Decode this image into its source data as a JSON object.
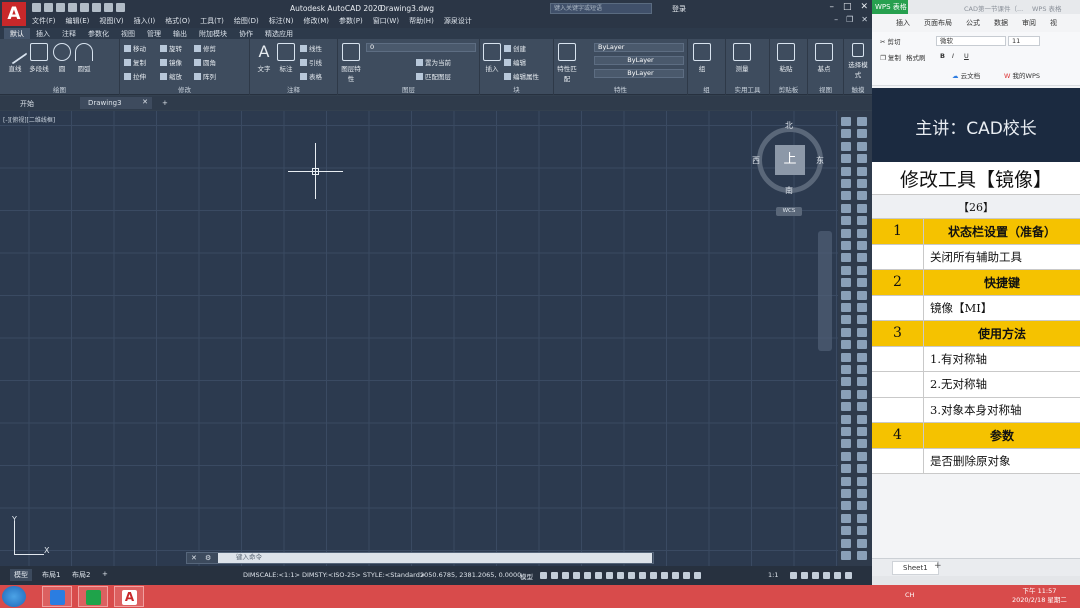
{
  "cad": {
    "title": "Autodesk AutoCAD 2020",
    "file": "Drawing3.dwg",
    "search_placeholder": "键入关键字或短语",
    "login": "登录",
    "menu": [
      "文件(F)",
      "编辑(E)",
      "视图(V)",
      "插入(I)",
      "格式(O)",
      "工具(T)",
      "绘图(D)",
      "标注(N)",
      "修改(M)",
      "参数(P)",
      "窗口(W)",
      "帮助(H)",
      "源泉设计"
    ],
    "ribbon_tabs": [
      "默认",
      "插入",
      "注释",
      "参数化",
      "视图",
      "管理",
      "输出",
      "附加模块",
      "协作",
      "精选应用"
    ],
    "panels": {
      "draw": {
        "label": "绘图",
        "tools": [
          "直线",
          "多段线",
          "圆",
          "圆弧"
        ]
      },
      "modify": {
        "label": "修改",
        "tools": [
          "移动",
          "旋转",
          "修剪",
          "复制",
          "镜像",
          "圆角",
          "拉伸",
          "缩放",
          "阵列"
        ]
      },
      "annotation": {
        "label": "注释",
        "tools": [
          "文字",
          "标注",
          "线性",
          "引线",
          "表格"
        ]
      },
      "layers": {
        "label": "图层",
        "big": "图层特性",
        "current_layer": "0",
        "tools": [
          "置为当前",
          "匹配图层"
        ]
      },
      "block": {
        "label": "块",
        "big": "插入",
        "tools": [
          "创建",
          "编辑",
          "编辑属性"
        ]
      },
      "properties": {
        "label": "特性",
        "big": "特性匹配",
        "combos": [
          "ByLayer",
          "ByLayer",
          "ByLayer"
        ]
      },
      "groups": {
        "label": "组",
        "big": "组"
      },
      "utilities": {
        "label": "实用工具",
        "big": "测量"
      },
      "clipboard": {
        "label": "剪贴板",
        "big": "粘贴"
      },
      "view": {
        "label": "视图",
        "big": "基点"
      },
      "touch": {
        "label": "触摸",
        "big": "选择模式"
      }
    },
    "doc_tabs": [
      "开始",
      "Drawing3"
    ],
    "viewport_label": "[-][俯视][二维线框]",
    "viewcube": {
      "face": "上",
      "north": "北",
      "south": "南",
      "east": "东",
      "west": "西",
      "wcs": "WCS"
    },
    "ucs": {
      "x": "X",
      "y": "Y"
    },
    "command_placeholder": "键入命令",
    "layout_tabs": [
      "模型",
      "布局1",
      "布局2"
    ],
    "status": {
      "sysvars": "DIMSCALE:<1:1> DIMSTY:<ISO-25> STYLE:<Standard>",
      "coords": "2050.6785, 2381.2065, 0.0000",
      "model": "模型",
      "scale": "1:1"
    }
  },
  "wps": {
    "app": "WPS 表格",
    "doc": "CAD第一节课件（...",
    "doc2": "WPS 表格",
    "menu": [
      "插入",
      "页面布局",
      "公式",
      "数据",
      "审阅",
      "视"
    ],
    "toolbar": {
      "cut": "剪切",
      "copy": "复制",
      "format_painter": "格式刷",
      "font": "微软",
      "size": "11",
      "cloud": "云文档",
      "my_wps": "我的WPS"
    },
    "slide_title": "主讲：CAD校长",
    "table": {
      "title": "修改工具【镜像】",
      "lesson": "【26】",
      "sections": [
        {
          "num": "1",
          "header": "状态栏设置（准备）",
          "items": [
            "关闭所有辅助工具"
          ]
        },
        {
          "num": "2",
          "header": "快捷键",
          "items": [
            "镜像【MI】"
          ]
        },
        {
          "num": "3",
          "header": "使用方法",
          "items": [
            "1.有对称轴",
            "2.无对称轴",
            "3.对象本身对称轴"
          ]
        },
        {
          "num": "4",
          "header": "参数",
          "items": [
            "是否删除原对象"
          ]
        }
      ]
    },
    "sheet_tab": "Sheet1"
  },
  "taskbar": {
    "tray": "CH",
    "time": "下午 11:57",
    "date": "2020/2/18 星期二"
  },
  "colors": {
    "highlight": "#f5c200",
    "slide_bg": "#1b2a40",
    "taskbar": "#d84b4b"
  }
}
